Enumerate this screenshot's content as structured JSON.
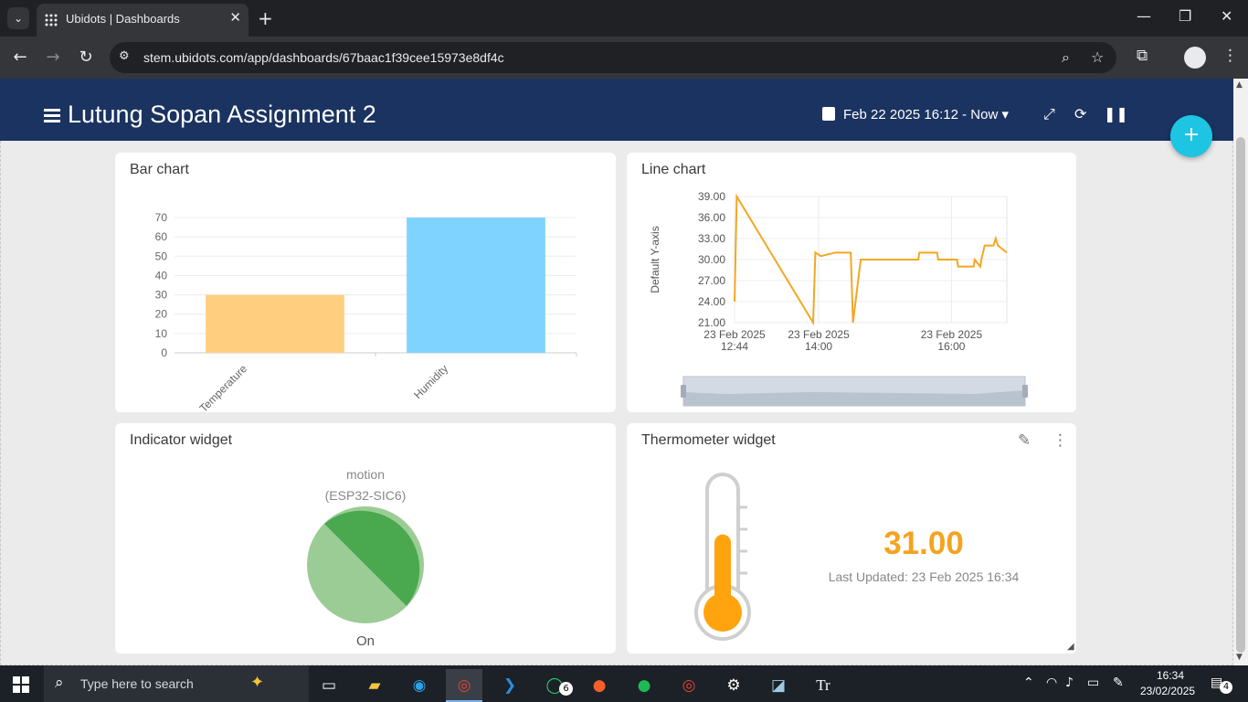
{
  "browser": {
    "tab_title": "Ubidots | Dashboards",
    "url": "stem.ubidots.com/app/dashboards/67baac1f39cee15973e8df4c"
  },
  "dashboard": {
    "title": "Lutung Sopan Assignment 2",
    "date_range": "Feb 22 2025 16:12 - Now"
  },
  "widgets": {
    "bar": {
      "title": "Bar chart"
    },
    "line": {
      "title": "Line chart",
      "ylabel": "Default Y-axis"
    },
    "indicator": {
      "title": "Indicator widget",
      "variable": "motion",
      "device": "(ESP32-SIC6)",
      "state": "On"
    },
    "thermometer": {
      "title": "Thermometer widget",
      "value": "31.00",
      "last_updated": "Last Updated: 23 Feb 2025 16:34",
      "fill_fraction": 0.28
    }
  },
  "chart_data": [
    {
      "type": "bar",
      "title": "Bar chart",
      "categories": [
        "Temperature",
        "Humidity"
      ],
      "values": [
        30,
        70
      ],
      "ylim": [
        0,
        70
      ],
      "yticks": [
        "0",
        "10",
        "20",
        "30",
        "40",
        "50",
        "60",
        "70"
      ],
      "colors": [
        "#ffcf7f",
        "#7fd4ff"
      ]
    },
    {
      "type": "line",
      "title": "Line chart",
      "ylabel": "Default Y-axis",
      "ylim": [
        21,
        39
      ],
      "yticks": [
        "21.00",
        "24.00",
        "27.00",
        "30.00",
        "33.00",
        "36.00",
        "39.00"
      ],
      "xticks": [
        {
          "date": "23 Feb 2025",
          "time": "12:44"
        },
        {
          "date": "23 Feb 2025",
          "time": "14:00"
        },
        {
          "date": "23 Feb 2025",
          "time": "16:00"
        }
      ],
      "color": "#f5a623",
      "series": [
        {
          "values": [
            [
              "12:44",
              24
            ],
            [
              "12:46",
              39
            ],
            [
              "13:55",
              21
            ],
            [
              "13:57",
              31
            ],
            [
              "14:02",
              30.5
            ],
            [
              "14:15",
              31
            ],
            [
              "14:29",
              31
            ],
            [
              "14:31",
              21
            ],
            [
              "14:38",
              30
            ],
            [
              "15:30",
              30
            ],
            [
              "15:31",
              31
            ],
            [
              "15:47",
              31
            ],
            [
              "15:48",
              30
            ],
            [
              "16:05",
              30
            ],
            [
              "16:06",
              29
            ],
            [
              "16:20",
              29
            ],
            [
              "16:21",
              30
            ],
            [
              "16:26",
              29
            ],
            [
              "16:27",
              30
            ],
            [
              "16:30",
              32
            ],
            [
              "16:38",
              32
            ],
            [
              "16:40",
              33
            ],
            [
              "16:42",
              32
            ],
            [
              "16:50",
              31
            ]
          ]
        }
      ]
    }
  ],
  "taskbar": {
    "search_placeholder": "Type here to search",
    "time": "16:34",
    "date": "23/02/2025",
    "whatsapp_badge": "6",
    "notif_count": "4"
  }
}
